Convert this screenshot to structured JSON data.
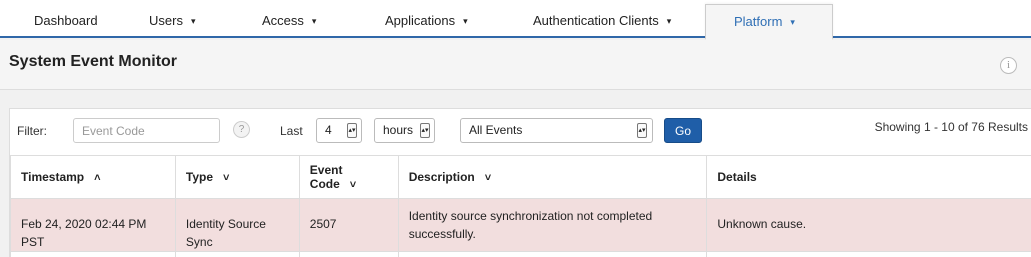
{
  "nav": {
    "items": [
      {
        "label": "Dashboard",
        "caret": ""
      },
      {
        "label": "Users",
        "caret": "▾"
      },
      {
        "label": "Access",
        "caret": "▾"
      },
      {
        "label": "Applications",
        "caret": "▾"
      },
      {
        "label": "Authentication Clients",
        "caret": "▾"
      },
      {
        "label": "Platform",
        "caret": "▾"
      }
    ],
    "active": "Platform"
  },
  "header": {
    "title": "System Event Monitor",
    "info_icon": "i"
  },
  "filter": {
    "label": "Filter:",
    "event_code_placeholder": "Event Code",
    "help_icon": "?",
    "last_label": "Last",
    "last_value": "4",
    "unit_value": "hours",
    "events_value": "All Events",
    "go_label": "Go",
    "results_text": "Showing 1 - 10 of 76 Results"
  },
  "table": {
    "columns": [
      {
        "label": "Timestamp",
        "sort": "^"
      },
      {
        "label": "Type",
        "sort": "v"
      },
      {
        "label": "Event Code",
        "sort": "v"
      },
      {
        "label": "Description",
        "sort": "v"
      },
      {
        "label": "Details",
        "sort": ""
      }
    ],
    "rows": [
      {
        "timestamp": "Feb 24, 2020 02:44 PM PST",
        "type": "Identity Source Sync",
        "event_code": "2507",
        "description": "Identity source synchronization not completed successfully.",
        "details": "Unknown cause."
      }
    ]
  },
  "colors": {
    "accent": "#2f67a8",
    "go_button": "#1f5ea8",
    "error_row": "#f2dede"
  }
}
